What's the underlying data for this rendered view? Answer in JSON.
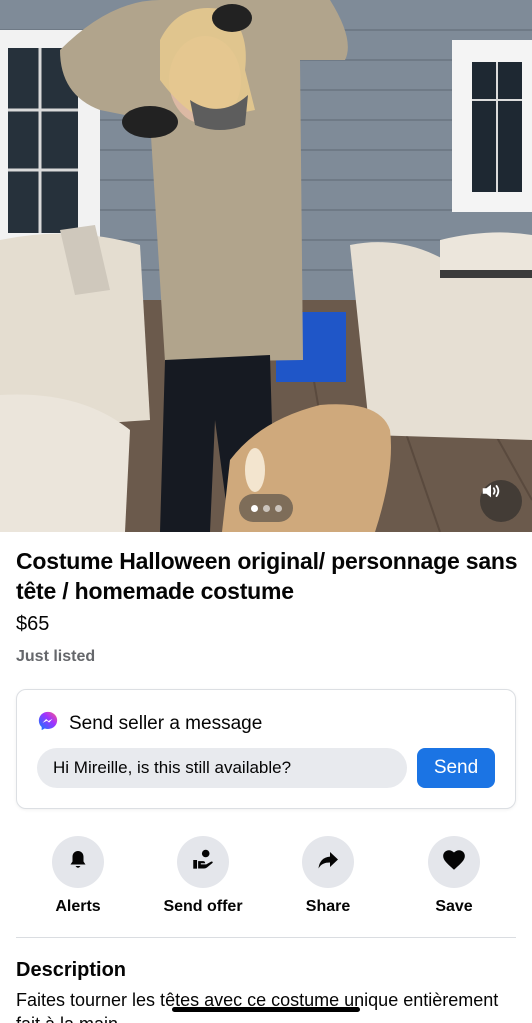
{
  "listing": {
    "title": "Costume Halloween original/ personnage sans tête / homemade costume",
    "price": "$65",
    "listed_status": "Just listed"
  },
  "media": {
    "carousel_position": 1,
    "carousel_total": 3,
    "volume_icon": "speaker-icon"
  },
  "message": {
    "heading": "Send seller a message",
    "input_value": "Hi Mireille, is this still available?",
    "send_label": "Send",
    "icon": "messenger-icon"
  },
  "actions": [
    {
      "label": "Alerts",
      "icon": "bell-icon"
    },
    {
      "label": "Send offer",
      "icon": "hand-offer-icon"
    },
    {
      "label": "Share",
      "icon": "share-arrow-icon"
    },
    {
      "label": "Save",
      "icon": "heart-icon"
    }
  ],
  "description": {
    "heading": "Description",
    "text": "Faites tourner les têtes avec ce costume unique entièrement fait à la main"
  },
  "colors": {
    "accent": "#1b74e4",
    "secondary_text": "#65676b",
    "circle_bg": "#e4e6eb"
  }
}
